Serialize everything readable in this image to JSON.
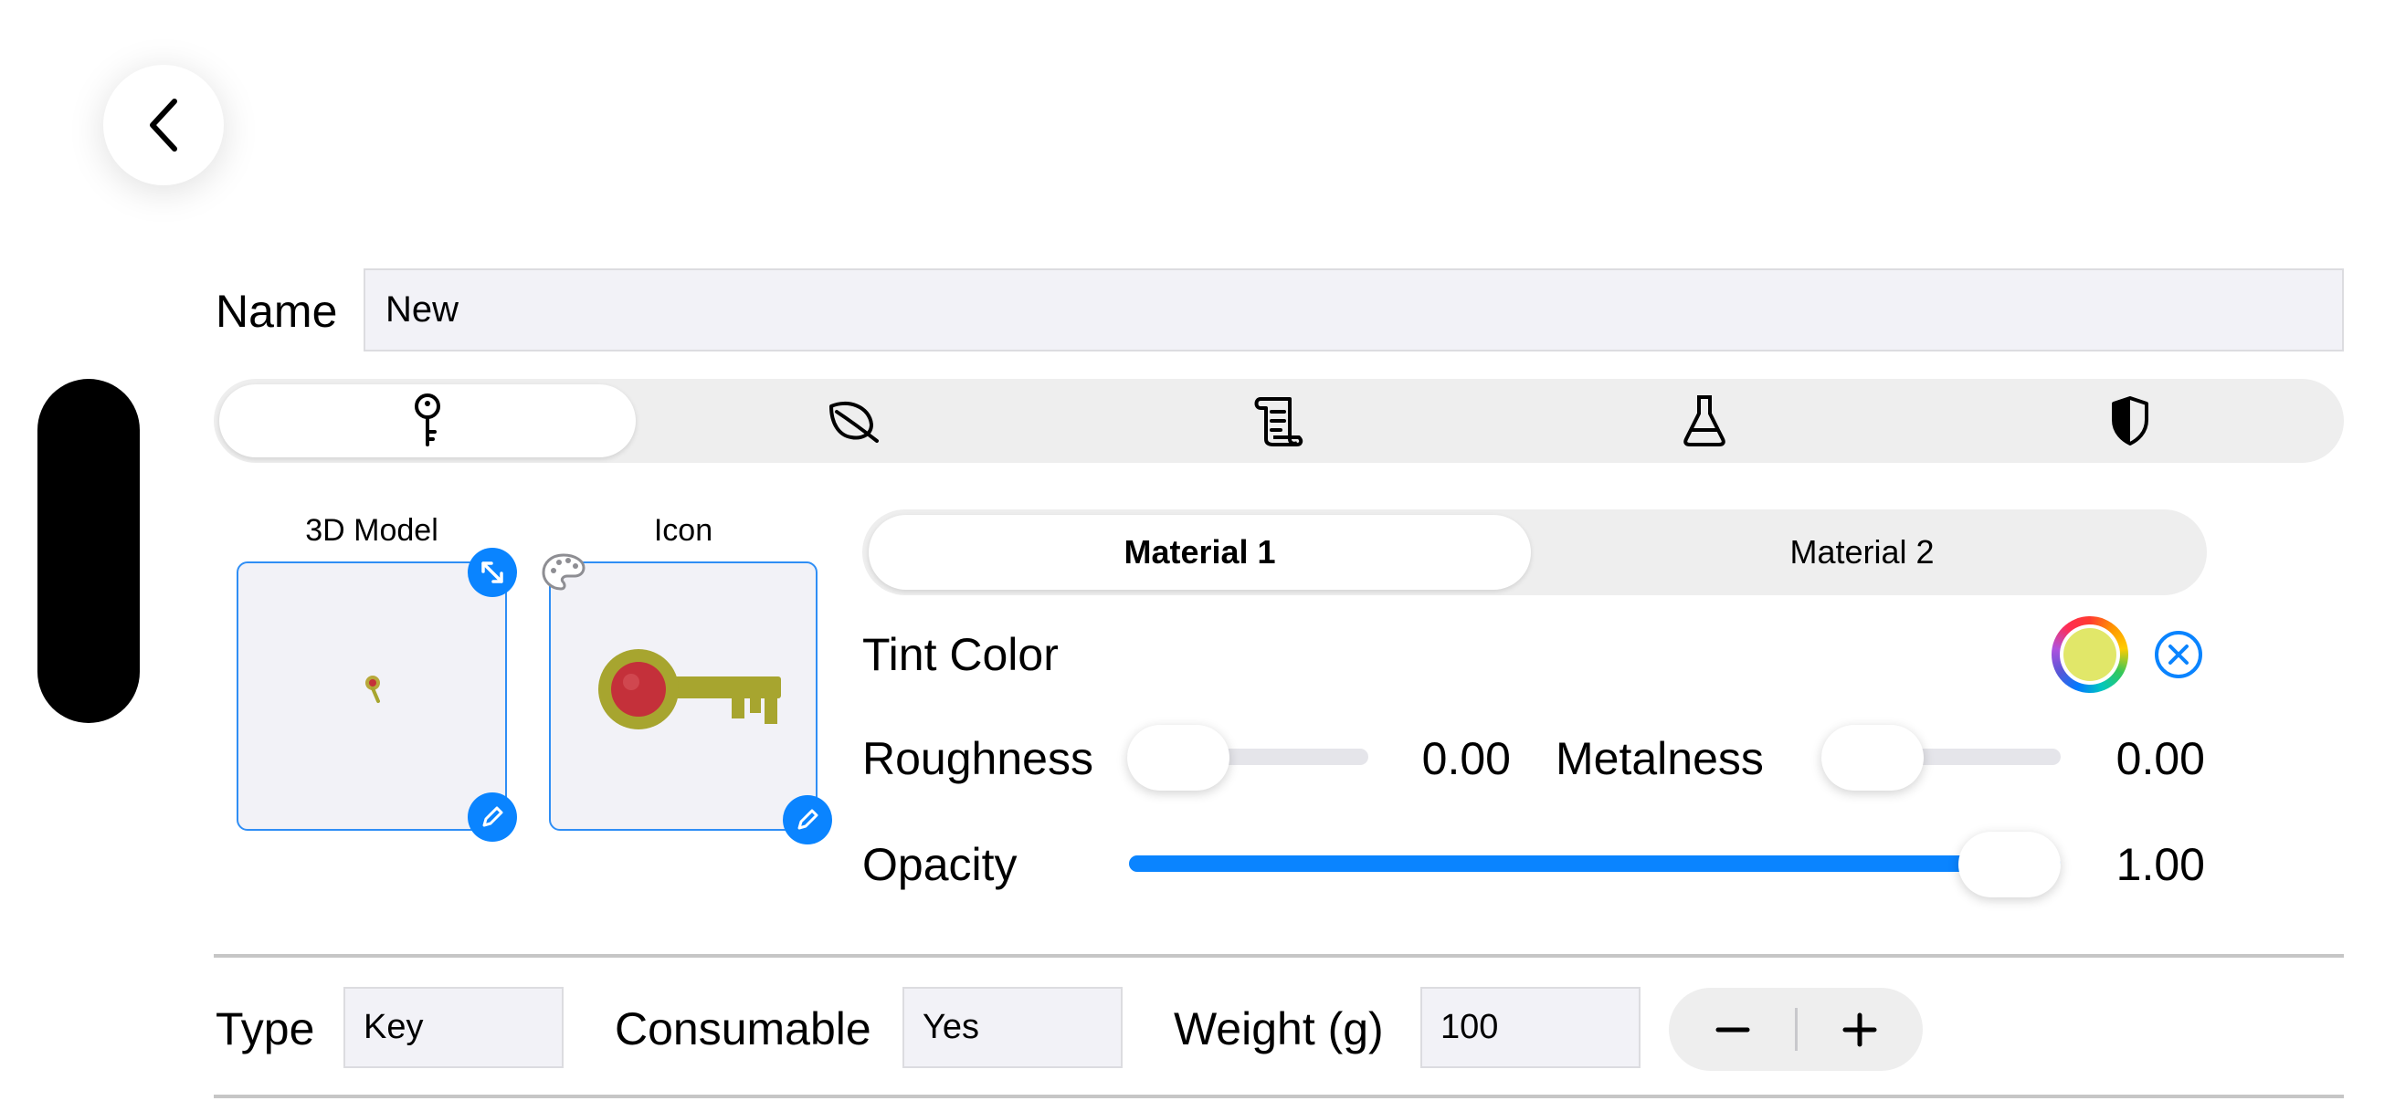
{
  "navigation": {
    "back_icon": "chevron-left-icon"
  },
  "name_field": {
    "label": "Name",
    "value": "New"
  },
  "category_tabs": [
    {
      "icon": "key-icon",
      "active": true
    },
    {
      "icon": "leaf-icon",
      "active": false
    },
    {
      "icon": "scroll-icon",
      "active": false
    },
    {
      "icon": "flask-icon",
      "active": false
    },
    {
      "icon": "shield-icon",
      "active": false
    }
  ],
  "previews": {
    "model": {
      "title": "3D Model",
      "corner_icon": "expand-icon",
      "edit_icon": "pencil-icon"
    },
    "icon": {
      "title": "Icon",
      "corner_icon": "palette-icon",
      "edit_icon": "pencil-icon"
    }
  },
  "materials": {
    "tabs": [
      "Material 1",
      "Material 2"
    ],
    "selected": 0,
    "tint": {
      "label": "Tint Color",
      "color": "#e1e769",
      "clear_icon": "close-circle-icon"
    },
    "roughness": {
      "label": "Roughness",
      "value": 0.0,
      "display": "0.00"
    },
    "metalness": {
      "label": "Metalness",
      "value": 0.0,
      "display": "0.00"
    },
    "opacity": {
      "label": "Opacity",
      "value": 1.0,
      "display": "1.00"
    }
  },
  "properties": {
    "type": {
      "label": "Type",
      "value": "Key"
    },
    "consumable": {
      "label": "Consumable",
      "value": "Yes"
    },
    "weight": {
      "label": "Weight (g)",
      "value": "100"
    },
    "stepper": {
      "minus_icon": "minus-icon",
      "plus_icon": "plus-icon"
    }
  },
  "colors": {
    "accent": "#0a84ff",
    "key_body": "#a7a52f",
    "key_gem": "#c4303a"
  }
}
